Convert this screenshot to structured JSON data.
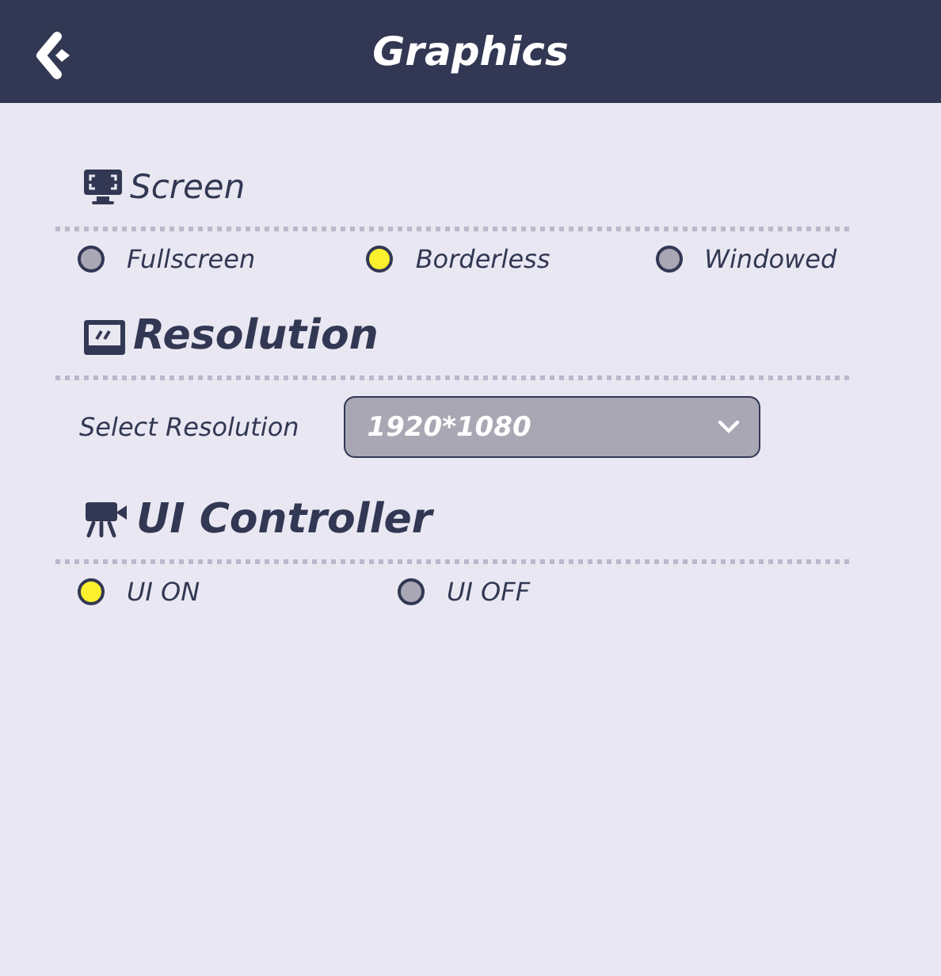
{
  "header": {
    "title": "Graphics"
  },
  "sections": [
    {
      "title": "Screen",
      "kind": "radios",
      "options": [
        {
          "label": "Fullscreen",
          "selected": false
        },
        {
          "label": "Borderless",
          "selected": true
        },
        {
          "label": "Windowed",
          "selected": false
        }
      ]
    },
    {
      "title": "Resolution",
      "kind": "select",
      "label": "Select Resolution",
      "value": "1920*1080"
    },
    {
      "title": "UI Controller",
      "kind": "radios",
      "options": [
        {
          "label": "UI ON",
          "selected": true
        },
        {
          "label": "UI OFF",
          "selected": false
        }
      ]
    }
  ]
}
